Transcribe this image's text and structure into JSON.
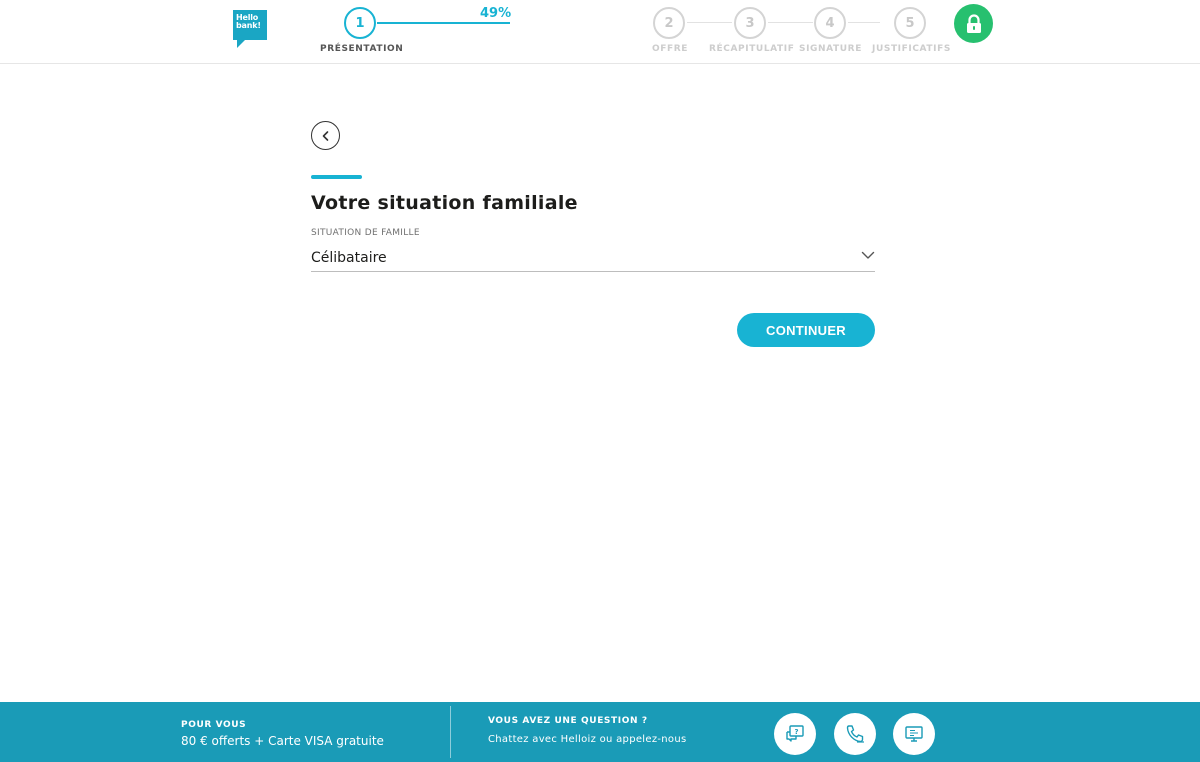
{
  "logo": {
    "line1": "Hello",
    "line2": "bank!"
  },
  "progress": {
    "percent_label": "49%",
    "percent": 49
  },
  "steps": [
    {
      "number": "1",
      "label": "PRÉSENTATION"
    },
    {
      "number": "2",
      "label": "OFFRE"
    },
    {
      "number": "3",
      "label": "RÉCAPITULATIF"
    },
    {
      "number": "4",
      "label": "SIGNATURE"
    },
    {
      "number": "5",
      "label": "JUSTIFICATIFS"
    }
  ],
  "main": {
    "title": "Votre situation familiale",
    "field_label": "SITUATION DE FAMILLE",
    "selected_value": "Célibataire",
    "continue_label": "CONTINUER"
  },
  "footer": {
    "offer_title": "POUR VOUS",
    "offer_text": "80 € offerts +  Carte VISA gratuite",
    "question_title": "VOUS AVEZ UNE QUESTION ?",
    "question_text": "Chattez avec Helloiz ou appelez-nous"
  },
  "colors": {
    "accent": "#18b3d3",
    "footer": "#1a9bb7",
    "lock": "#27c06f"
  },
  "icons": [
    "back-arrow-icon",
    "chevron-down-icon",
    "lock-icon",
    "chat-question-icon",
    "phone-icon",
    "screen-share-icon"
  ]
}
